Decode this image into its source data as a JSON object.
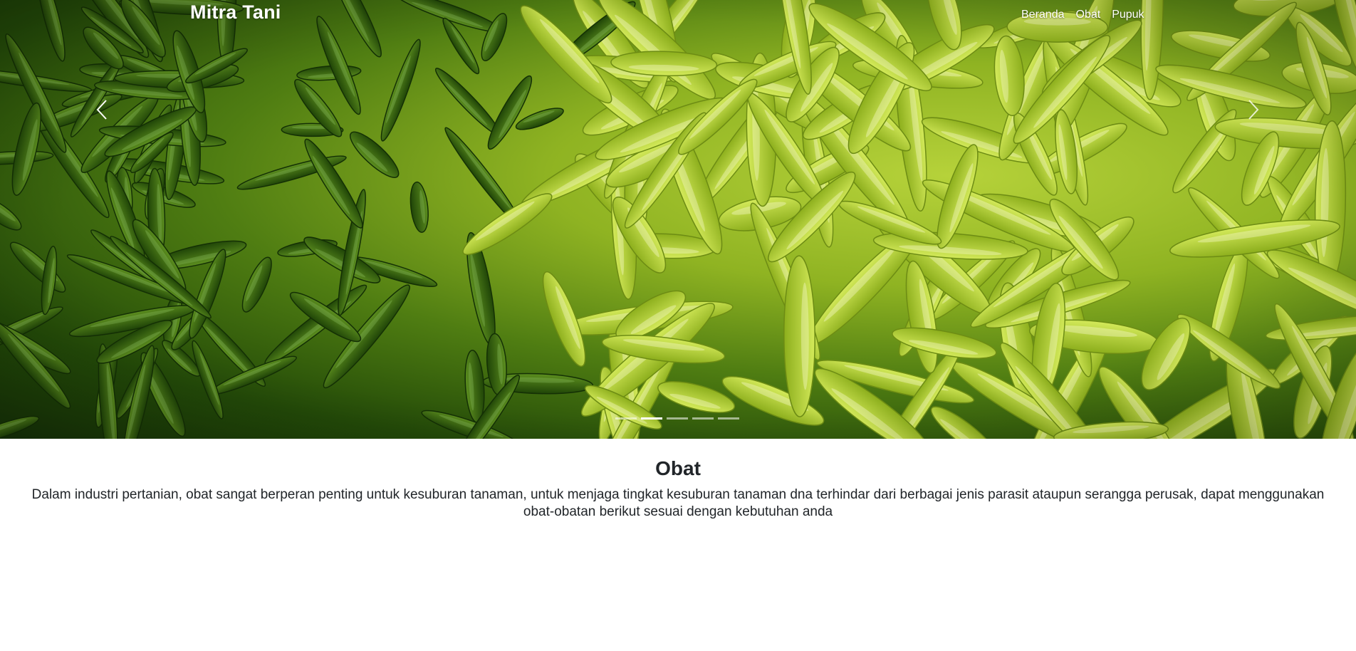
{
  "navbar": {
    "brand": "Mitra Tani",
    "links": [
      "Beranda",
      "Obat",
      "Pupuk"
    ]
  },
  "carousel": {
    "slide_count": 5,
    "active_index": 1,
    "prev_icon": "chevron-left-icon",
    "next_icon": "chevron-right-icon"
  },
  "section": {
    "title": "Obat",
    "description": "Dalam industri pertanian, obat sangat berperan penting untuk kesuburan tanaman, untuk menjaga tingkat kesuburan tanaman dna terhindar dari berbagai jenis parasit ataupun serangga perusak, dapat menggunakan obat-obatan berikut sesuai dengan kebutuhan anda"
  },
  "colors": {
    "text": "#212529",
    "nav_text": "#ffffff",
    "pepper_dark": "#2f5e0c",
    "pepper_light": "#a9c92c"
  }
}
